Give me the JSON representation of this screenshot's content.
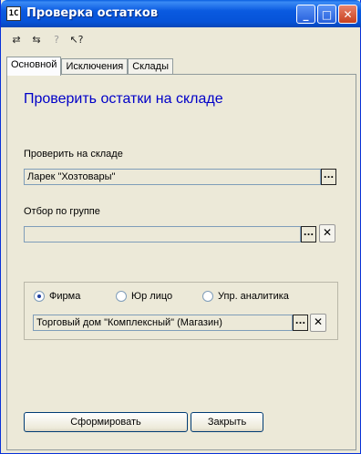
{
  "window": {
    "title": "Проверка остатков",
    "icon": "1c-icon",
    "controls": {
      "minimize": "_",
      "maximize": "□",
      "close": "✕"
    }
  },
  "toolbar": {
    "items": [
      {
        "name": "toolbar-icon-1",
        "glyph": "⇄",
        "disabled": false
      },
      {
        "name": "toolbar-icon-2",
        "glyph": "⇆",
        "disabled": false
      },
      {
        "name": "toolbar-icon-3",
        "glyph": "?",
        "disabled": true
      },
      {
        "name": "toolbar-icon-4",
        "glyph": "↖?",
        "disabled": false
      }
    ]
  },
  "tabs": [
    {
      "label": "Основной",
      "active": true
    },
    {
      "label": "Исключения",
      "active": false
    },
    {
      "label": "Склады",
      "active": false
    }
  ],
  "main": {
    "heading": "Проверить остатки на складе",
    "warehouse": {
      "label": "Проверить на складе",
      "value": "Ларек \"Хозтовары\"",
      "select_button": "..."
    },
    "group_filter": {
      "label": "Отбор по группе",
      "value": "",
      "select_button": "...",
      "clear_button": "✕"
    },
    "entity": {
      "options": [
        {
          "label": "Фирма",
          "checked": true
        },
        {
          "label": "Юр лицо",
          "checked": false
        },
        {
          "label": "Упр. аналитика",
          "checked": false
        }
      ],
      "value": "Торговый дом \"Комплексный\" (Магазин)",
      "select_button": "...",
      "clear_button": "✕"
    }
  },
  "footer": {
    "generate_button": "Сформировать",
    "close_button": "Закрыть"
  }
}
